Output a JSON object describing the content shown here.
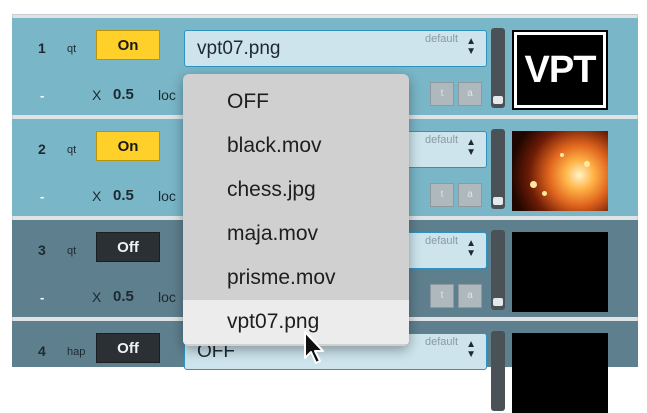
{
  "rows": [
    {
      "num": "1",
      "type": "qt",
      "state": "On",
      "file": "vpt07.png",
      "default_label": "default",
      "scale_x": "X",
      "scale": "0.5",
      "loc": "loc",
      "t": "t",
      "a": "a",
      "preview": "VPT"
    },
    {
      "num": "2",
      "type": "qt",
      "state": "On",
      "default_label": "default",
      "scale_x": "X",
      "scale": "0.5",
      "loc": "loc",
      "t": "t",
      "a": "a"
    },
    {
      "num": "3",
      "type": "qt",
      "state": "Off",
      "default_label": "default",
      "scale_x": "X",
      "scale": "0.5",
      "loc": "loc",
      "t": "t",
      "a": "a"
    },
    {
      "num": "4",
      "type": "hap",
      "state": "Off",
      "file": "OFF",
      "default_label": "default"
    }
  ],
  "dropdown": {
    "options": [
      "OFF",
      "black.mov",
      "chess.jpg",
      "maja.mov",
      "prisme.mov",
      "vpt07.png"
    ],
    "highlighted": "vpt07.png"
  },
  "colors": {
    "on": "#ffd02a",
    "off": "#2b3035",
    "row_active": "#79b6c7",
    "row_inactive": "#5e7f8e",
    "select_border": "#2e93c0"
  }
}
